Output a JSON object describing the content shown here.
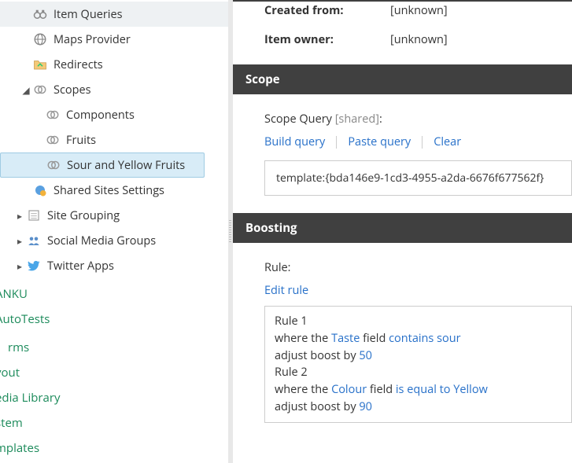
{
  "tree": {
    "item_queries": "Item Queries",
    "maps_provider": "Maps Provider",
    "redirects": "Redirects",
    "scopes": "Scopes",
    "components": "Components",
    "fruits": "Fruits",
    "sour_yellow": "Sour and Yellow Fruits",
    "shared_sites": "Shared Sites Settings",
    "site_grouping": "Site Grouping",
    "social_media": "Social Media Groups",
    "twitter_apps": "Twitter Apps"
  },
  "roots": {
    "anku": "ANKU",
    "autotests": "AutoTests",
    "rms": "rms",
    "yout": "yout",
    "edia": "edia Library",
    "stem": "stem",
    "mplates": "mplates"
  },
  "detail": {
    "created_from_label": "Created from:",
    "created_from_value": "[unknown]",
    "item_owner_label": "Item owner:",
    "item_owner_value": "[unknown]"
  },
  "scope": {
    "header": "Scope",
    "query_label": "Scope Query",
    "query_shared": "[shared]",
    "actions": {
      "build": "Build query",
      "paste": "Paste query",
      "clear": "Clear"
    },
    "query_value": "template:{bda146e9-1cd3-4955-a2da-6676f677562f}"
  },
  "boosting": {
    "header": "Boosting",
    "rule_label": "Rule:",
    "edit_rule": "Edit rule",
    "rules": [
      {
        "title": "Rule 1",
        "parts": [
          "where the ",
          "Taste",
          " field ",
          "contains sour"
        ],
        "adjust_prefix": "adjust boost by ",
        "adjust_value": "50"
      },
      {
        "title": "Rule 2",
        "parts": [
          "where the ",
          "Colour",
          " field ",
          "is equal to Yellow"
        ],
        "adjust_prefix": "adjust boost by ",
        "adjust_value": "90"
      }
    ]
  }
}
